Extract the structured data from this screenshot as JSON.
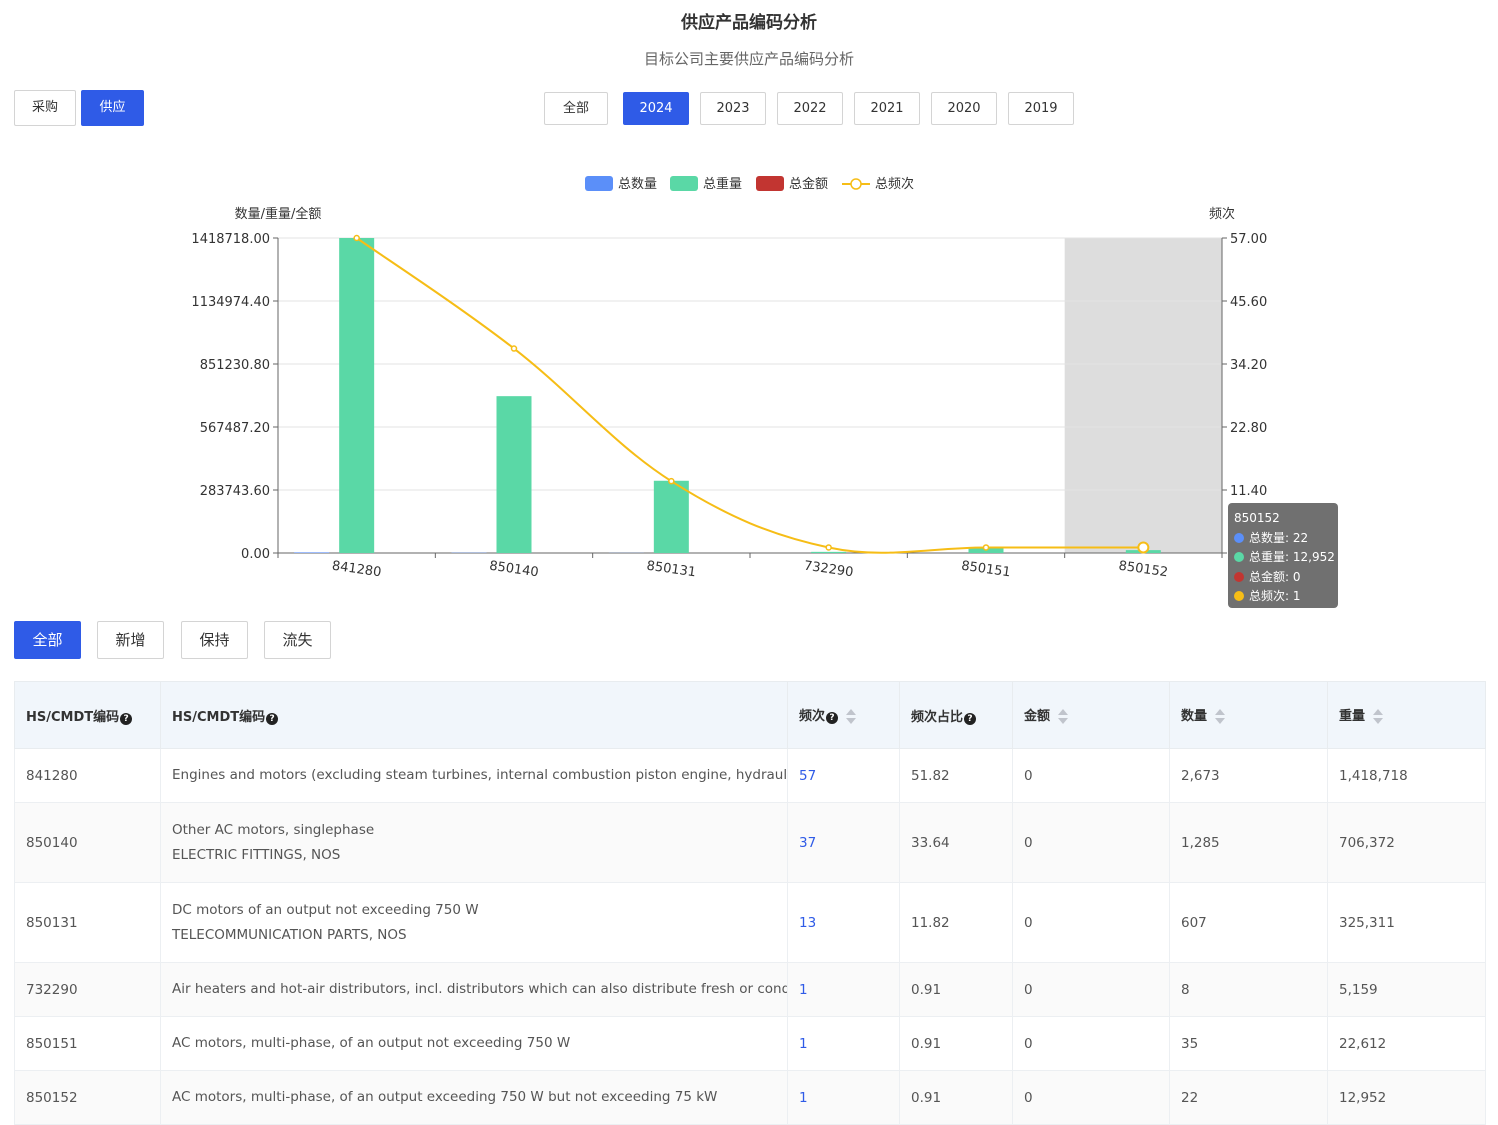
{
  "header": {
    "title": "供应产品编码分析",
    "subtitle": "目标公司主要供应产品编码分析"
  },
  "mode_tabs": [
    {
      "label": "采购",
      "active": false
    },
    {
      "label": "供应",
      "active": true
    }
  ],
  "year_filters": [
    {
      "label": "全部",
      "active": false
    },
    {
      "label": "2024",
      "active": true
    },
    {
      "label": "2023",
      "active": false
    },
    {
      "label": "2022",
      "active": false
    },
    {
      "label": "2021",
      "active": false
    },
    {
      "label": "2020",
      "active": false
    },
    {
      "label": "2019",
      "active": false
    }
  ],
  "status_filters": [
    {
      "label": "全部",
      "active": true
    },
    {
      "label": "新增",
      "active": false
    },
    {
      "label": "保持",
      "active": false
    },
    {
      "label": "流失",
      "active": false
    }
  ],
  "colors": {
    "accent": "#2f5be7",
    "qty": "#5b8ff9",
    "weight": "#5ad8a6",
    "amount": "#c23531",
    "freq": "#f6bd16",
    "highlight": "#dddddd"
  },
  "chart_data": {
    "type": "bar",
    "categories": [
      "841280",
      "850140",
      "850131",
      "732290",
      "850151",
      "850152"
    ],
    "series": [
      {
        "name": "总数量",
        "type": "bar",
        "axis": "left",
        "values": [
          2673,
          1285,
          607,
          8,
          35,
          22
        ]
      },
      {
        "name": "总重量",
        "type": "bar",
        "axis": "left",
        "values": [
          1418718,
          706372,
          325311,
          5159,
          22612,
          12952
        ]
      },
      {
        "name": "总金额",
        "type": "bar",
        "axis": "left",
        "values": [
          0,
          0,
          0,
          0,
          0,
          0
        ]
      },
      {
        "name": "总频次",
        "type": "line",
        "axis": "right",
        "values": [
          57,
          37,
          13,
          1,
          1,
          1
        ]
      }
    ],
    "ylabel": "数量/重量/全额",
    "y2label": "频次",
    "ylim": [
      0,
      1418718
    ],
    "y2lim": [
      0,
      57
    ],
    "yticks": [
      "0.00",
      "283743.60",
      "567487.20",
      "851230.80",
      "1134974.40",
      "1418718.00"
    ],
    "y2ticks": [
      "",
      "11.40",
      "22.80",
      "34.20",
      "45.60",
      "57.00"
    ],
    "legend_position": "top-center",
    "grid": true,
    "highlighted_category": "850152",
    "tooltip": {
      "title": "850152",
      "rows": [
        {
          "label": "总数量: 22",
          "color": "#5b8ff9"
        },
        {
          "label": "总重量: 12,952",
          "color": "#5ad8a6"
        },
        {
          "label": "总金额: 0",
          "color": "#c23531"
        },
        {
          "label": "总频次: 1",
          "color": "#f6bd16"
        }
      ]
    }
  },
  "table": {
    "headers": [
      "HS/CMDT编码",
      "HS/CMDT编码",
      "频次",
      "频次占比",
      "金额",
      "数量",
      "重量"
    ],
    "rows": [
      {
        "code": "841280",
        "desc": [
          "Engines and motors (excluding steam turbines, internal combustion piston engine, hydraulic turbines, water wheels, gas turbines and electric motors)"
        ],
        "freq": "57",
        "ratio": "51.82",
        "amount": "0",
        "qty": "2,673",
        "weight": "1,418,718"
      },
      {
        "code": "850140",
        "desc": [
          "Other AC motors, singlephase",
          "ELECTRIC FITTINGS, NOS"
        ],
        "freq": "37",
        "ratio": "33.64",
        "amount": "0",
        "qty": "1,285",
        "weight": "706,372"
      },
      {
        "code": "850131",
        "desc": [
          "DC motors of an output not exceeding 750 W",
          "TELECOMMUNICATION PARTS, NOS"
        ],
        "freq": "13",
        "ratio": "11.82",
        "amount": "0",
        "qty": "607",
        "weight": "325,311"
      },
      {
        "code": "732290",
        "desc": [
          "Air heaters and hot-air distributors, incl. distributors which can also distribute fresh or conditioned air, non-electrically heated"
        ],
        "freq": "1",
        "ratio": "0.91",
        "amount": "0",
        "qty": "8",
        "weight": "5,159"
      },
      {
        "code": "850151",
        "desc": [
          "AC motors, multi-phase, of an output not exceeding 750 W"
        ],
        "freq": "1",
        "ratio": "0.91",
        "amount": "0",
        "qty": "35",
        "weight": "22,612"
      },
      {
        "code": "850152",
        "desc": [
          "AC motors, multi-phase, of an output exceeding 750 W but not exceeding 75 kW"
        ],
        "freq": "1",
        "ratio": "0.91",
        "amount": "0",
        "qty": "22",
        "weight": "12,952"
      }
    ]
  }
}
